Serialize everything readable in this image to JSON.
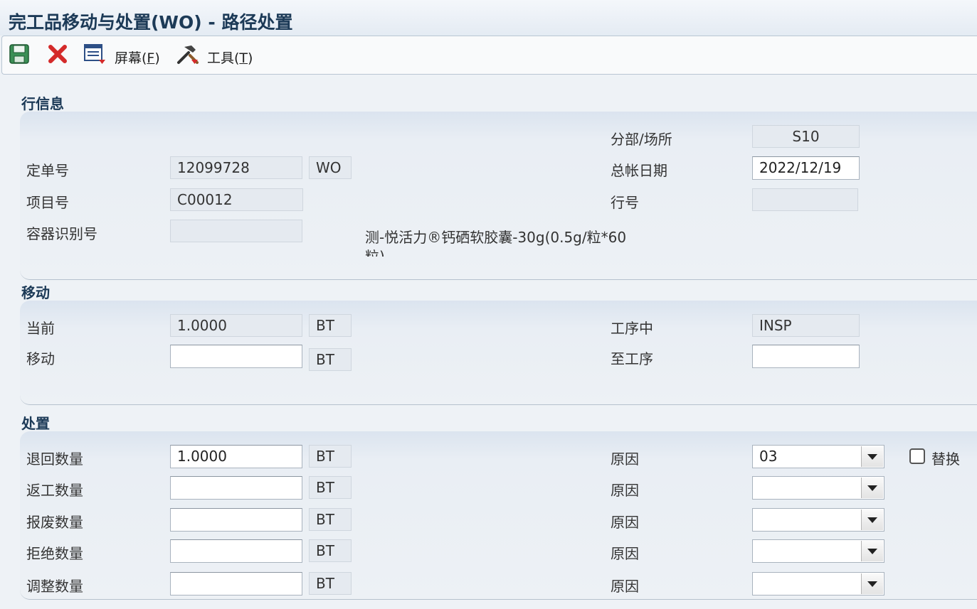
{
  "window": {
    "title": "完工品移动与处置(WO) - 路径处置"
  },
  "toolbar": {
    "save_icon": "save-disk-icon",
    "close_icon": "close-x-icon",
    "screen_icon": "screen-menu-icon",
    "tools_icon": "tools-menu-icon",
    "screen_label": "屏幕(",
    "screen_key": "F",
    "tools_label": "工具(",
    "tools_key": "T",
    "paren_close": ")"
  },
  "line_info": {
    "section_title": "行信息",
    "branch_label": "分部/场所",
    "branch_value": "S10",
    "order_label": "定单号",
    "order_number": "12099728",
    "order_type": "WO",
    "gl_date_label": "总帐日期",
    "gl_date": "2022/12/19",
    "item_label": "项目号",
    "item_number": "C00012",
    "line_no_label": "行号",
    "line_no": "",
    "container_label": "容器识别号",
    "container_id": "",
    "description": "测-悦活力®钙硒软胶囊-30g(0.5g/粒*60",
    "description_cont": "粒)"
  },
  "move": {
    "section_title": "移动",
    "current_label": "当前",
    "current_qty": "1.0000",
    "current_uom": "BT",
    "in_operation_label": "工序中",
    "in_operation": "INSP",
    "move_label": "移动",
    "move_qty": "",
    "move_uom": "BT",
    "to_operation_label": "至工序",
    "to_operation": ""
  },
  "disposition": {
    "section_title": "处置",
    "reason_label": "原因",
    "rows": [
      {
        "label": "退回数量",
        "qty": "1.0000",
        "uom": "BT",
        "reason": "03"
      },
      {
        "label": "返工数量",
        "qty": "",
        "uom": "BT",
        "reason": ""
      },
      {
        "label": "报废数量",
        "qty": "",
        "uom": "BT",
        "reason": ""
      },
      {
        "label": "拒绝数量",
        "qty": "",
        "uom": "BT",
        "reason": ""
      },
      {
        "label": "调整数量",
        "qty": "",
        "uom": "BT",
        "reason": ""
      }
    ],
    "replace_label": "替换",
    "replace_checked": false
  }
}
